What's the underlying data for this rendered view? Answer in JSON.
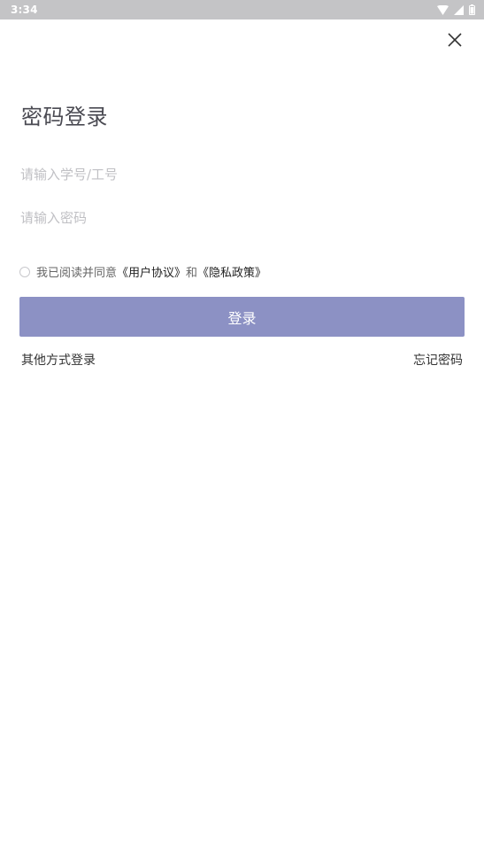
{
  "status_bar": {
    "time": "3:34",
    "icons": [
      "wifi-icon",
      "signal-icon",
      "battery-icon"
    ]
  },
  "header": {
    "close_icon": "close-icon"
  },
  "page": {
    "title": "密码登录"
  },
  "form": {
    "username_placeholder": "请输入学号/工号",
    "username_value": "",
    "password_placeholder": "请输入密码",
    "password_value": ""
  },
  "agreement": {
    "checked": false,
    "prefix": "我已阅读并同意",
    "user_agreement": "《用户协议》",
    "and": "和",
    "privacy_policy": "《隐私政策》"
  },
  "login_button": {
    "label": "登录"
  },
  "footer": {
    "other_login": "其他方式登录",
    "forgot_password": "忘记密码"
  },
  "colors": {
    "status_bar": "#c4c4c6",
    "button": "#8c91c4",
    "title": "#4a4a52",
    "placeholder": "#c0c0c4"
  }
}
